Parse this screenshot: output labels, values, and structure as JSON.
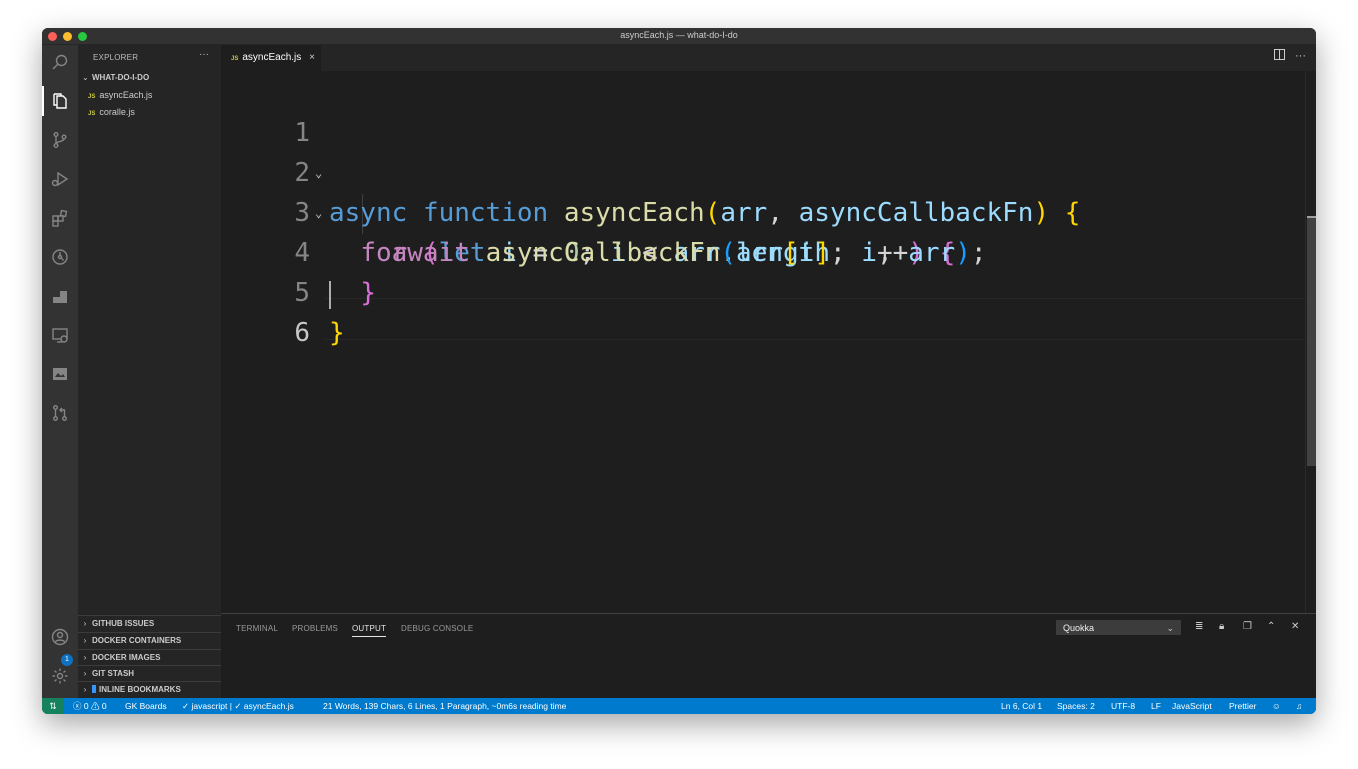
{
  "window": {
    "title": "asyncEach.js — what-do-I-do"
  },
  "activity_bar": {
    "icons": [
      "search-icon",
      "files-icon",
      "source-control-icon",
      "run-debug-icon",
      "extensions-icon",
      "gitlens-icon",
      "docker-icon",
      "remote-explorer-icon",
      "gallery-icon",
      "pull-requests-icon",
      "account-icon",
      "settings-gear-icon"
    ],
    "account_badge": "1"
  },
  "sidebar": {
    "header": "EXPLORER",
    "more": "···",
    "folder": "WHAT-DO-I-DO",
    "files": [
      {
        "icon": "JS",
        "name": "asyncEach.js"
      },
      {
        "icon": "JS",
        "name": "coralle.js"
      }
    ],
    "sections": [
      "GITHUB ISSUES",
      "DOCKER CONTAINERS",
      "DOCKER IMAGES",
      "GIT STASH",
      "INLINE BOOKMARKS"
    ]
  },
  "editor": {
    "tab": {
      "icon": "JS",
      "label": "asyncEach.js",
      "close": "×"
    },
    "line_numbers": [
      "1",
      "2",
      "3",
      "4",
      "5",
      "6"
    ],
    "code": {
      "l1": [
        "async",
        "function",
        "asyncEach",
        "(",
        "arr",
        ",",
        "asyncCallbackFn",
        ")",
        "{"
      ],
      "l2": [
        "for",
        "(",
        "let",
        "i",
        "=",
        "0",
        ";",
        "i",
        "<",
        "arr",
        ".",
        "length",
        ";",
        "i",
        "++",
        ")",
        "{"
      ],
      "l3": [
        "await",
        "asyncCallbackFn",
        "(",
        "arr",
        "[",
        "i",
        "]",
        ",",
        "i",
        ",",
        "arr",
        ")",
        ";"
      ],
      "l4": [
        "}"
      ],
      "l5": [
        "}"
      ]
    }
  },
  "panel": {
    "tabs": [
      "TERMINAL",
      "PROBLEMS",
      "OUTPUT",
      "DEBUG CONSOLE"
    ],
    "active_tab": "OUTPUT",
    "output_channel": "Quokka"
  },
  "status_bar": {
    "errors": "0",
    "warnings": "0",
    "gk_boards": "GK Boards",
    "lint": "✓ javascript | ✓ asyncEach.js",
    "word_count": "21 Words, 139 Chars, 6 Lines, 1 Paragraph, ~0m6s reading time",
    "position": "Ln 6, Col 1",
    "spaces": "Spaces: 2",
    "encoding": "UTF-8",
    "eol": "LF",
    "language": "JavaScript",
    "formatter": "Prettier"
  }
}
